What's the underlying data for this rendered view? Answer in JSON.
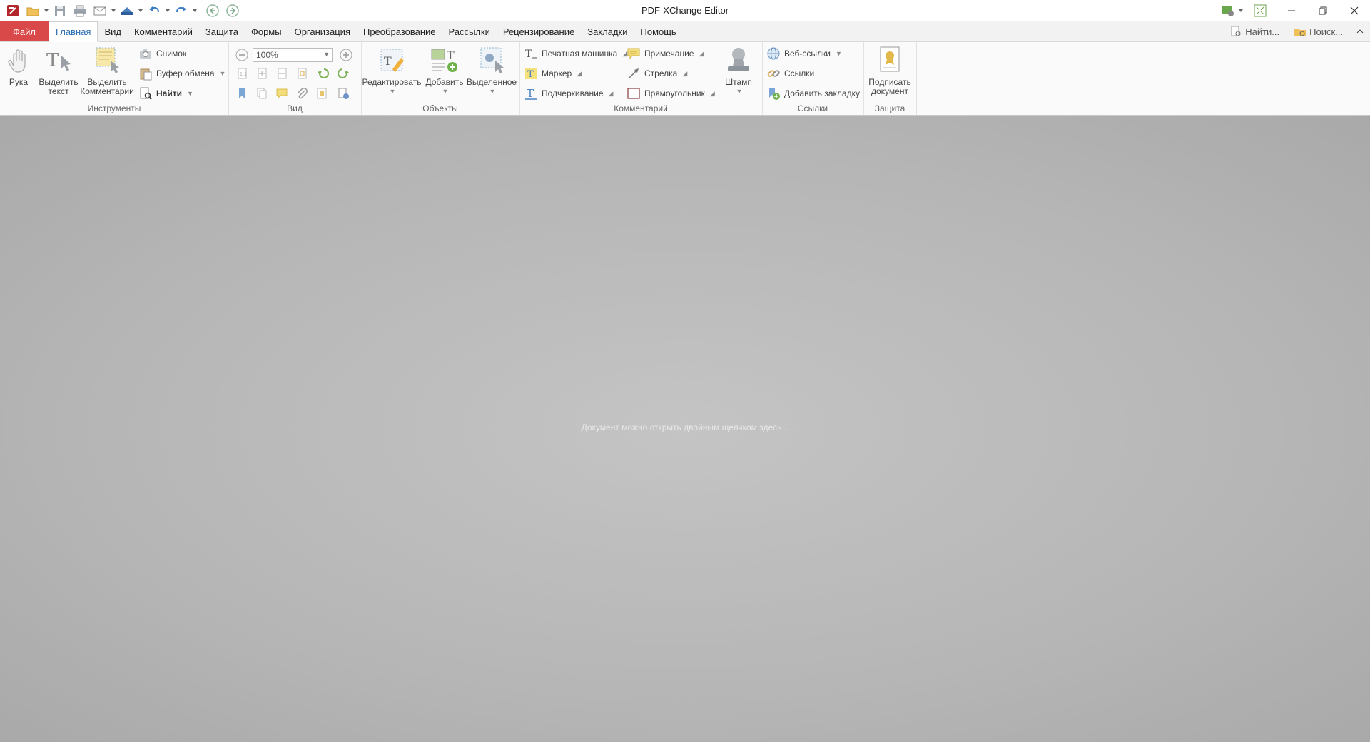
{
  "window": {
    "title": "PDF-XChange Editor"
  },
  "menu": {
    "items": [
      "Файл",
      "Главная",
      "Вид",
      "Комментарий",
      "Защита",
      "Формы",
      "Организация",
      "Преобразование",
      "Рассылки",
      "Рецензирование",
      "Закладки",
      "Помощь"
    ],
    "active_index": 1,
    "find_label": "Найти...",
    "search_label": "Поиск..."
  },
  "ribbon": {
    "tools": {
      "label": "Инструменты",
      "hand": "Рука",
      "select_text_1": "Выделить",
      "select_text_2": "текст",
      "select_comments_1": "Выделить",
      "select_comments_2": "Комментарии",
      "snapshot": "Снимок",
      "clipboard": "Буфер обмена",
      "find": "Найти"
    },
    "view": {
      "label": "Вид",
      "zoom": "100%"
    },
    "objects": {
      "label": "Объекты",
      "edit": "Редактировать",
      "add": "Добавить",
      "selected": "Выделенное"
    },
    "comments": {
      "label": "Комментарий",
      "typewriter": "Печатная машинка",
      "marker": "Маркер",
      "underline": "Подчеркивание",
      "note": "Примечание",
      "arrow": "Стрелка",
      "rectangle": "Прямоугольник",
      "stamp": "Штамп"
    },
    "links": {
      "label": "Ссылки",
      "web_links": "Веб-ссылки",
      "links": "Ссылки",
      "add_bookmark": "Добавить закладку"
    },
    "protect": {
      "label": "Защита",
      "sign_1": "Подписать",
      "sign_2": "документ"
    }
  },
  "workspace": {
    "hint": "Документ можно открыть двойным щелчком здесь..."
  },
  "colors": {
    "file_tab": "#d94949",
    "active_tab_text": "#2b6db3"
  }
}
